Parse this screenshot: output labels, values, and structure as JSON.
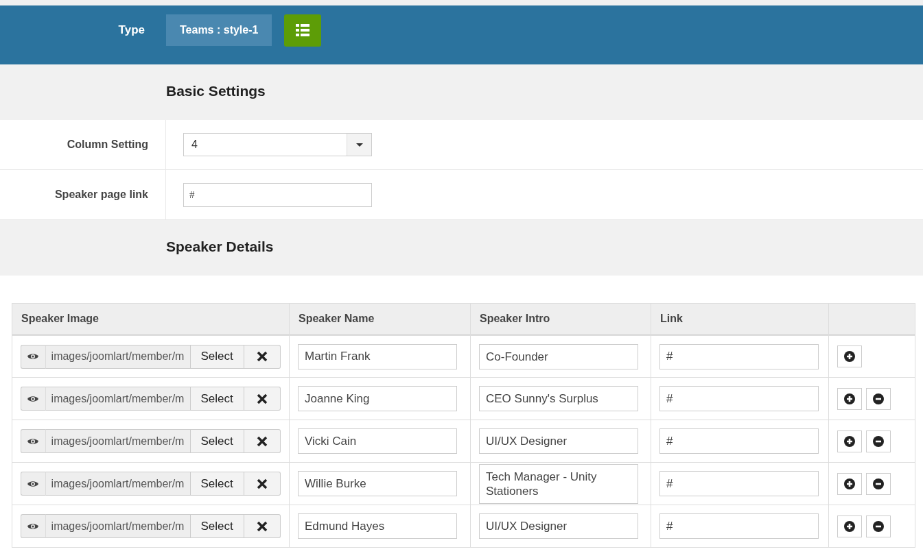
{
  "header": {
    "type_label": "Type",
    "type_value": "Teams : style-1"
  },
  "basic_settings": {
    "title": "Basic Settings",
    "fields": [
      {
        "kind": "select",
        "label": "Column Setting",
        "value": "4"
      },
      {
        "kind": "text",
        "label": "Speaker page link",
        "value": "#"
      }
    ]
  },
  "speaker_details": {
    "title": "Speaker Details",
    "columns": [
      "Speaker Image",
      "Speaker Name",
      "Speaker Intro",
      "Link"
    ],
    "rows": [
      {
        "image": "images/joomlart/member/m",
        "select": "Select",
        "name": "Martin Frank",
        "intro": "Co-Founder",
        "link": "#",
        "removable": false
      },
      {
        "image": "images/joomlart/member/m",
        "select": "Select",
        "name": "Joanne King",
        "intro": "CEO Sunny's Surplus",
        "link": "#",
        "removable": true
      },
      {
        "image": "images/joomlart/member/m",
        "select": "Select",
        "name": "Vicki Cain",
        "intro": "UI/UX Designer",
        "link": "#",
        "removable": true
      },
      {
        "image": "images/joomlart/member/m",
        "select": "Select",
        "name": "Willie Burke",
        "intro": "Tech Manager - Unity Stationers",
        "link": "#",
        "removable": true
      },
      {
        "image": "images/joomlart/member/m",
        "select": "Select",
        "name": "Edmund Hayes",
        "intro": "UI/UX Designer",
        "link": "#",
        "removable": true
      }
    ]
  }
}
